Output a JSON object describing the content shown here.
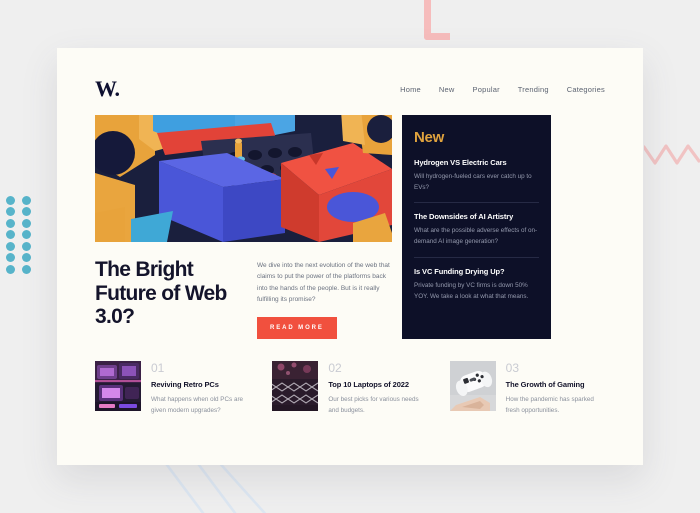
{
  "page": {
    "background_color": "#efefef",
    "card_background": "#fdfcf6"
  },
  "decorations": {
    "pink_corner": {
      "name": "pink-l-shape",
      "color": "#f6bcbc"
    },
    "dot_grid": {
      "name": "teal-dot-grid",
      "color": "#57b4ca",
      "rows": 7,
      "cols": 3
    },
    "zigzag": {
      "name": "pink-zigzag-line",
      "color": "#f2c2c2"
    },
    "diagonal_lines": {
      "name": "blue-diagonal-lines",
      "color": "#d8e4f0"
    }
  },
  "header": {
    "logo": "W.",
    "nav": [
      {
        "label": "Home"
      },
      {
        "label": "New"
      },
      {
        "label": "Popular"
      },
      {
        "label": "Trending"
      },
      {
        "label": "Categories"
      }
    ]
  },
  "hero": {
    "image_alt": "colorful 3d geometric blocks",
    "title": "The Bright Future of Web 3.0?",
    "description": "We dive into the next evolution of the web that claims to put the power of the platforms back into the hands of the people. But is it really fulfilling its promise?",
    "cta_label": "READ MORE",
    "cta_color": "#f1503e"
  },
  "new_panel": {
    "heading": "New",
    "heading_color": "#e0a33e",
    "background": "#0d1028",
    "items": [
      {
        "title": "Hydrogen VS Electric Cars",
        "description": "Will hydrogen-fueled cars ever catch up to EVs?"
      },
      {
        "title": "The Downsides of AI Artistry",
        "description": "What are the possible adverse effects of on-demand AI image generation?"
      },
      {
        "title": "Is VC Funding Drying Up?",
        "description": "Private funding by VC firms is down 50% YOY. We take a look at what that means."
      }
    ]
  },
  "articles": [
    {
      "number": "01",
      "title": "Reviving Retro PCs",
      "description": "What happens when old PCs are given modern upgrades?",
      "thumb_alt": "retro computers with neon lighting"
    },
    {
      "number": "02",
      "title": "Top 10 Laptops of 2022",
      "description": "Our best picks for various needs and budgets.",
      "thumb_alt": "dark laptop keyboard with pink bokeh"
    },
    {
      "number": "03",
      "title": "The Growth of Gaming",
      "description": "How the pandemic has sparked fresh opportunities.",
      "thumb_alt": "white game controller held in hand"
    }
  ]
}
